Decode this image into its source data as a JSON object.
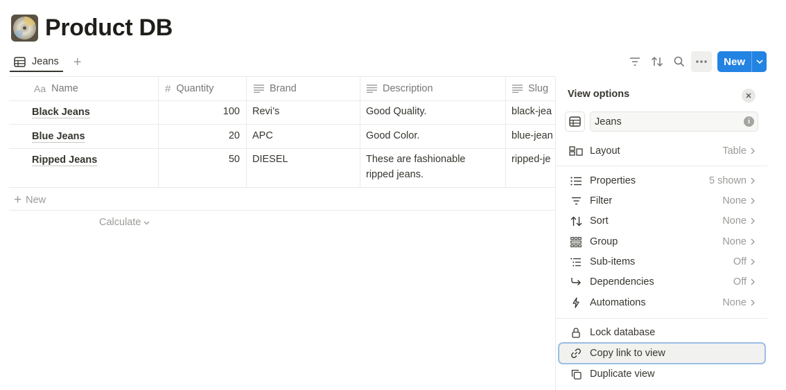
{
  "page": {
    "title": "Product DB",
    "icon": "cd-icon"
  },
  "view_tabs": {
    "active": "Jeans",
    "add_label": "+"
  },
  "toolbar": {
    "new_label": "New",
    "accent": "#2383e2"
  },
  "table": {
    "columns": [
      {
        "label": "Name",
        "icon": "Aa"
      },
      {
        "label": "Quantity",
        "icon": "#"
      },
      {
        "label": "Brand",
        "icon": "text-icon"
      },
      {
        "label": "Description",
        "icon": "text-icon"
      },
      {
        "label": "Slug",
        "icon": "text-icon"
      }
    ],
    "rows": [
      {
        "name": "Black Jeans",
        "quantity": "100",
        "brand": "Revi’s",
        "description": "Good Quality.",
        "description2": "",
        "slug": "black-jea"
      },
      {
        "name": "Blue Jeans",
        "quantity": "20",
        "brand": "APC",
        "description": "Good Color.",
        "description2": "",
        "slug": "blue-jean"
      },
      {
        "name": "Ripped Jeans",
        "quantity": "50",
        "brand": "DIESEL",
        "description": "These are fashionable",
        "description2": "ripped jeans.",
        "slug": "ripped-je"
      }
    ],
    "new_row_label": "New",
    "calculate_label": "Calculate"
  },
  "panel": {
    "title": "View options",
    "view_name": "Jeans",
    "options": [
      {
        "label": "Layout",
        "value": "Table",
        "icon": "layout-icon"
      },
      {
        "label": "Properties",
        "value": "5 shown",
        "icon": "list-icon"
      },
      {
        "label": "Filter",
        "value": "None",
        "icon": "filter-icon"
      },
      {
        "label": "Sort",
        "value": "None",
        "icon": "sort-icon"
      },
      {
        "label": "Group",
        "value": "None",
        "icon": "group-icon"
      },
      {
        "label": "Sub-items",
        "value": "Off",
        "icon": "subitems-icon"
      },
      {
        "label": "Dependencies",
        "value": "Off",
        "icon": "dependencies-icon"
      },
      {
        "label": "Automations",
        "value": "None",
        "icon": "lightning-icon"
      }
    ],
    "actions": [
      {
        "label": "Lock database",
        "icon": "lock-icon"
      },
      {
        "label": "Copy link to view",
        "icon": "link-icon"
      },
      {
        "label": "Duplicate view",
        "icon": "duplicate-icon"
      }
    ]
  }
}
